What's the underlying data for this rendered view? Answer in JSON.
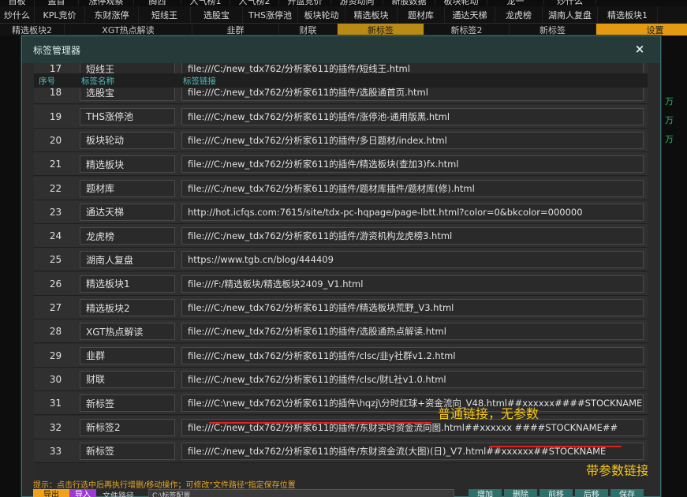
{
  "background": {
    "row0": [
      "自板",
      "盖首",
      "涨停观察",
      "腾西",
      "人气榜1",
      "人气榜2",
      "开盘竞价",
      "游资动向",
      "新股数据",
      "板块轮动",
      "龙一",
      "炒什么"
    ],
    "row1": [
      "炒什么",
      "KPL竞价",
      "东财涨停",
      "短线王",
      "选股宝",
      "THS涨停池",
      "板块轮动",
      "精选板块",
      "题材库",
      "通达天梯",
      "龙虎榜",
      "湖南人复盘",
      "精选板块1"
    ],
    "row2": [
      "精选板块2",
      "XGT热点解读",
      "韭群",
      "财联",
      "新标签",
      "新标签2",
      "新标签",
      "设置"
    ],
    "side_values": [
      "万",
      "万",
      "万"
    ]
  },
  "dialog": {
    "title": "标签管理器",
    "close_label": "×",
    "columns": {
      "num": "序号",
      "name": "标签名称",
      "link": "标签链接"
    },
    "rows": [
      {
        "num": "17",
        "name": "短线王",
        "link": "file:///C:/new_tdx762/分析家611的插件/短线王.html"
      },
      {
        "num": "18",
        "name": "选股宝",
        "link": "file:///C:/new_tdx762/分析家611的插件/选股通首页.html"
      },
      {
        "num": "19",
        "name": "THS涨停池",
        "link": "file:///C:/new_tdx762/分析家611的插件/涨停池-通用版黑.html"
      },
      {
        "num": "20",
        "name": "板块轮动",
        "link": "file:///C:/new_tdx762/分析家611的插件/多日题材/index.html"
      },
      {
        "num": "21",
        "name": "精选板块",
        "link": "file:///C:/new_tdx762/分析家611的插件/精选板块(查加3)fx.html"
      },
      {
        "num": "22",
        "name": "题材库",
        "link": "file:///C:/new_tdx762/分析家611的插件/题材库插件/题材库(修).html"
      },
      {
        "num": "23",
        "name": "通达天梯",
        "link": "http://hot.icfqs.com:7615/site/tdx-pc-hqpage/page-lbtt.html?color=0&bkcolor=000000"
      },
      {
        "num": "24",
        "name": "龙虎榜",
        "link": "file:///C:/new_tdx762/分析家611的插件/游资机构龙虎榜3.html"
      },
      {
        "num": "25",
        "name": "湖南人复盘",
        "link": "https://www.tgb.cn/blog/444409"
      },
      {
        "num": "26",
        "name": "精选板块1",
        "link": "file:///F:/精选板块/精选板块2409_V1.html"
      },
      {
        "num": "27",
        "name": "精选板块2",
        "link": "file:///C:/new_tdx762/分析家611的插件/精选板块荒野_V3.html"
      },
      {
        "num": "28",
        "name": "XGT热点解读",
        "link": "file:///C:/new_tdx762/分析家611的插件/选股通热点解读.html"
      },
      {
        "num": "29",
        "name": "韭群",
        "link": "file:///C:/new_tdx762/分析家611的插件/clsc/韭y社群v1.2.html"
      },
      {
        "num": "30",
        "name": "财联",
        "link": "file:///C:/new_tdx762/分析家611的插件/clsc/财L社v1.0.html"
      },
      {
        "num": "31",
        "name": "新标签",
        "link": "file:///C:\\new_tdx762\\分析家611的插件\\hqzj\\分时红球+资金流向_V48.html##xxxxxx####STOCKNAME##"
      },
      {
        "num": "32",
        "name": "新标签2",
        "link": "file:///C:/new_tdx762/分析家611的插件/东财实时资金流向图.html##xxxxxx ####STOCKNAME##"
      },
      {
        "num": "33",
        "name": "新标签",
        "link": "file:///C:/new_tdx762/分析家611的插件/东财资金流(大图)(日)_V7.html##xxxxxx##STOCKNAME"
      }
    ],
    "annotations": {
      "plain_link": "普通链接，无参数",
      "param_link": "带参数链接"
    },
    "footer": {
      "hint": "提示：点击行选中后再执行增删/移动操作；可修改\"文件路径\"指定保存位置",
      "export_label": "导出",
      "import_label": "导入",
      "path_label": "文件路径",
      "path_value": "C:\\标签配置",
      "actions": [
        "增加",
        "删除",
        "前移",
        "后移",
        "保存"
      ]
    }
  }
}
